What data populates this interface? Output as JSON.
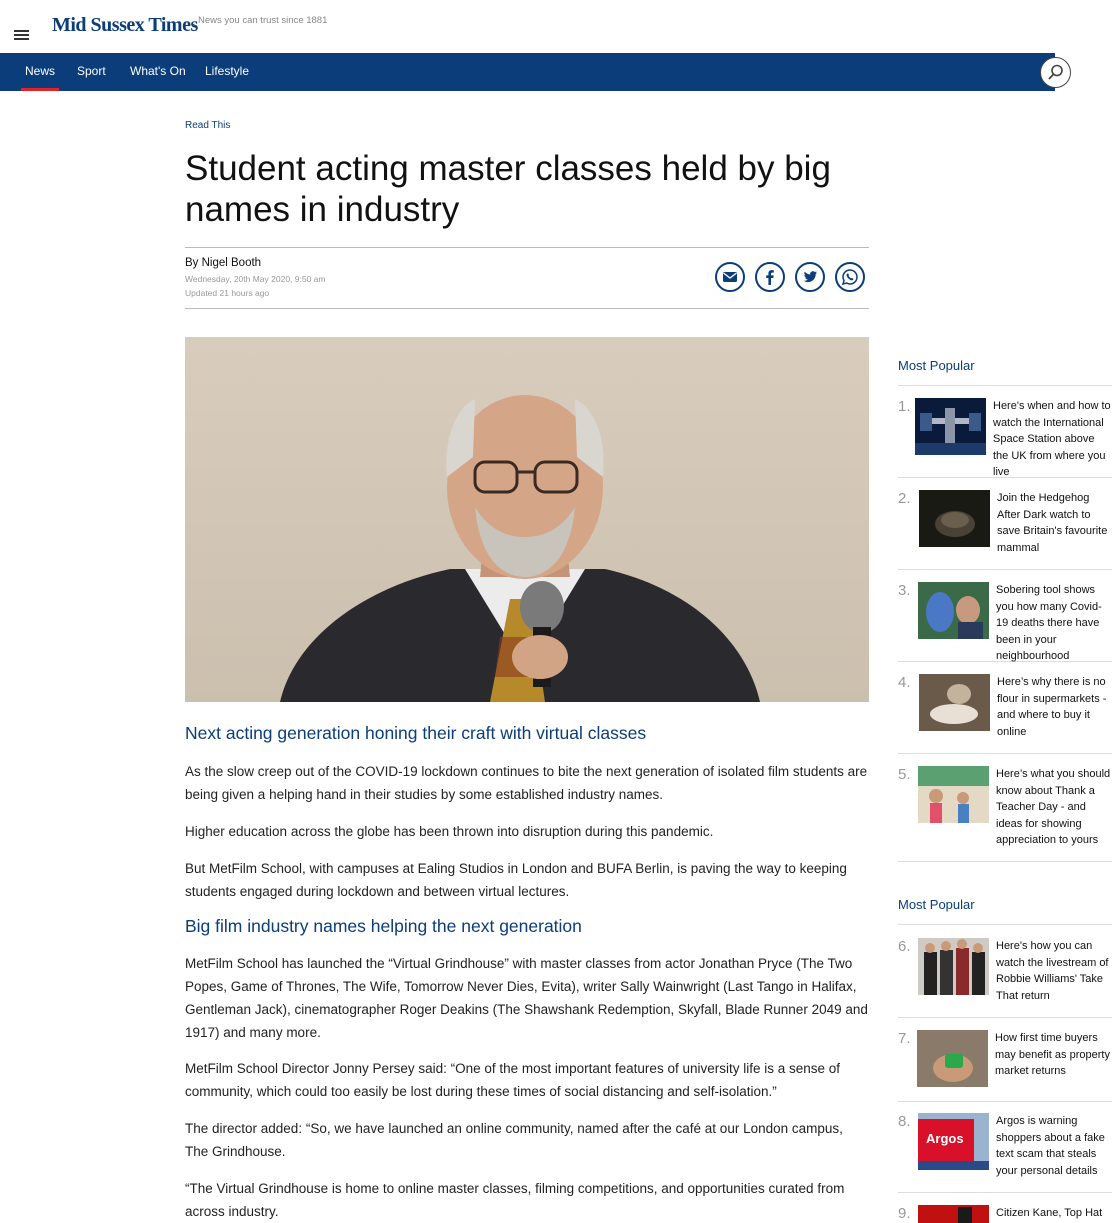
{
  "header": {
    "logo": "Mid Sussex Times",
    "tagline": "News you can trust since 1881",
    "nav": [
      {
        "label": "News"
      },
      {
        "label": "Sport"
      },
      {
        "label": "What's On"
      },
      {
        "label": "Lifestyle"
      }
    ]
  },
  "article": {
    "kicker": "Read This",
    "headline": "Student acting master classes held by big names in industry",
    "byline": "By Nigel Booth",
    "date": "Wednesday, 20th May 2020, 9:50 am",
    "updated": "Updated  21 hours ago",
    "subheads": [
      "Next acting generation honing their craft with virtual classes",
      "Big film industry names helping the next generation"
    ],
    "paragraphs": [
      "As the slow creep out of the COVID-19 lockdown continues to bite the next generation of isolated film students are being given a helping hand in their studies by some established industry names.",
      "Higher education across the globe has been thrown into disruption during this pandemic.",
      "But MetFilm School, with campuses at Ealing Studios in London and BUFA Berlin, is paving the way to keeping students engaged during lockdown and between virtual lectures.",
      "MetFilm School has launched the “Virtual Grindhouse” with master classes from actor Jonathan Pryce (The Two Popes, Game of Thrones, The Wife, Tomorrow Never Dies, Evita), writer Sally Wainwright (Last Tango in Halifax, Gentleman Jack), cinematographer Roger Deakins (The Shawshank Redemption, Skyfall, Blade Runner 2049 and 1917) and many more.",
      "MetFilm School Director Jonny Persey said: “One of the most important features of university life is a sense of community, which could too easily be lost during these times of social distancing and self-isolation.”",
      "The director added: “So, we have launched an online community, named after the café at our London campus, The Grindhouse.",
      "“The Virtual Grindhouse is home to online master classes, filming competitions, and opportunities curated from across industry."
    ]
  },
  "sidebar": {
    "titles": [
      "Most Popular",
      "Most Popular"
    ],
    "items": [
      {
        "num": "1.",
        "text": "Here's when and how to watch the International Space Station above the UK from where you live"
      },
      {
        "num": "2.",
        "text": "Join the Hedgehog After Dark watch to save Britain's favourite mammal"
      },
      {
        "num": "3.",
        "text": "Sobering tool shows you how many Covid-19 deaths there have been in your neighbourhood"
      },
      {
        "num": "4.",
        "text": "Here’s why there is no flour in supermarkets - and where to buy it online"
      },
      {
        "num": "5.",
        "text": "Here’s what you should know about Thank a Teacher Day - and ideas for showing appreciation to yours"
      },
      {
        "num": "6.",
        "text": "Here's how you can watch the livestream of Robbie Williams' Take That return"
      },
      {
        "num": "7.",
        "text": "How first time buyers may benefit as property market returns"
      },
      {
        "num": "8.",
        "text": "Argos is warning shoppers about a fake text scam that steals your personal details"
      },
      {
        "num": "9.",
        "text": "Citizen Kane, Top Hat"
      }
    ],
    "argos_sign": "Argos"
  }
}
